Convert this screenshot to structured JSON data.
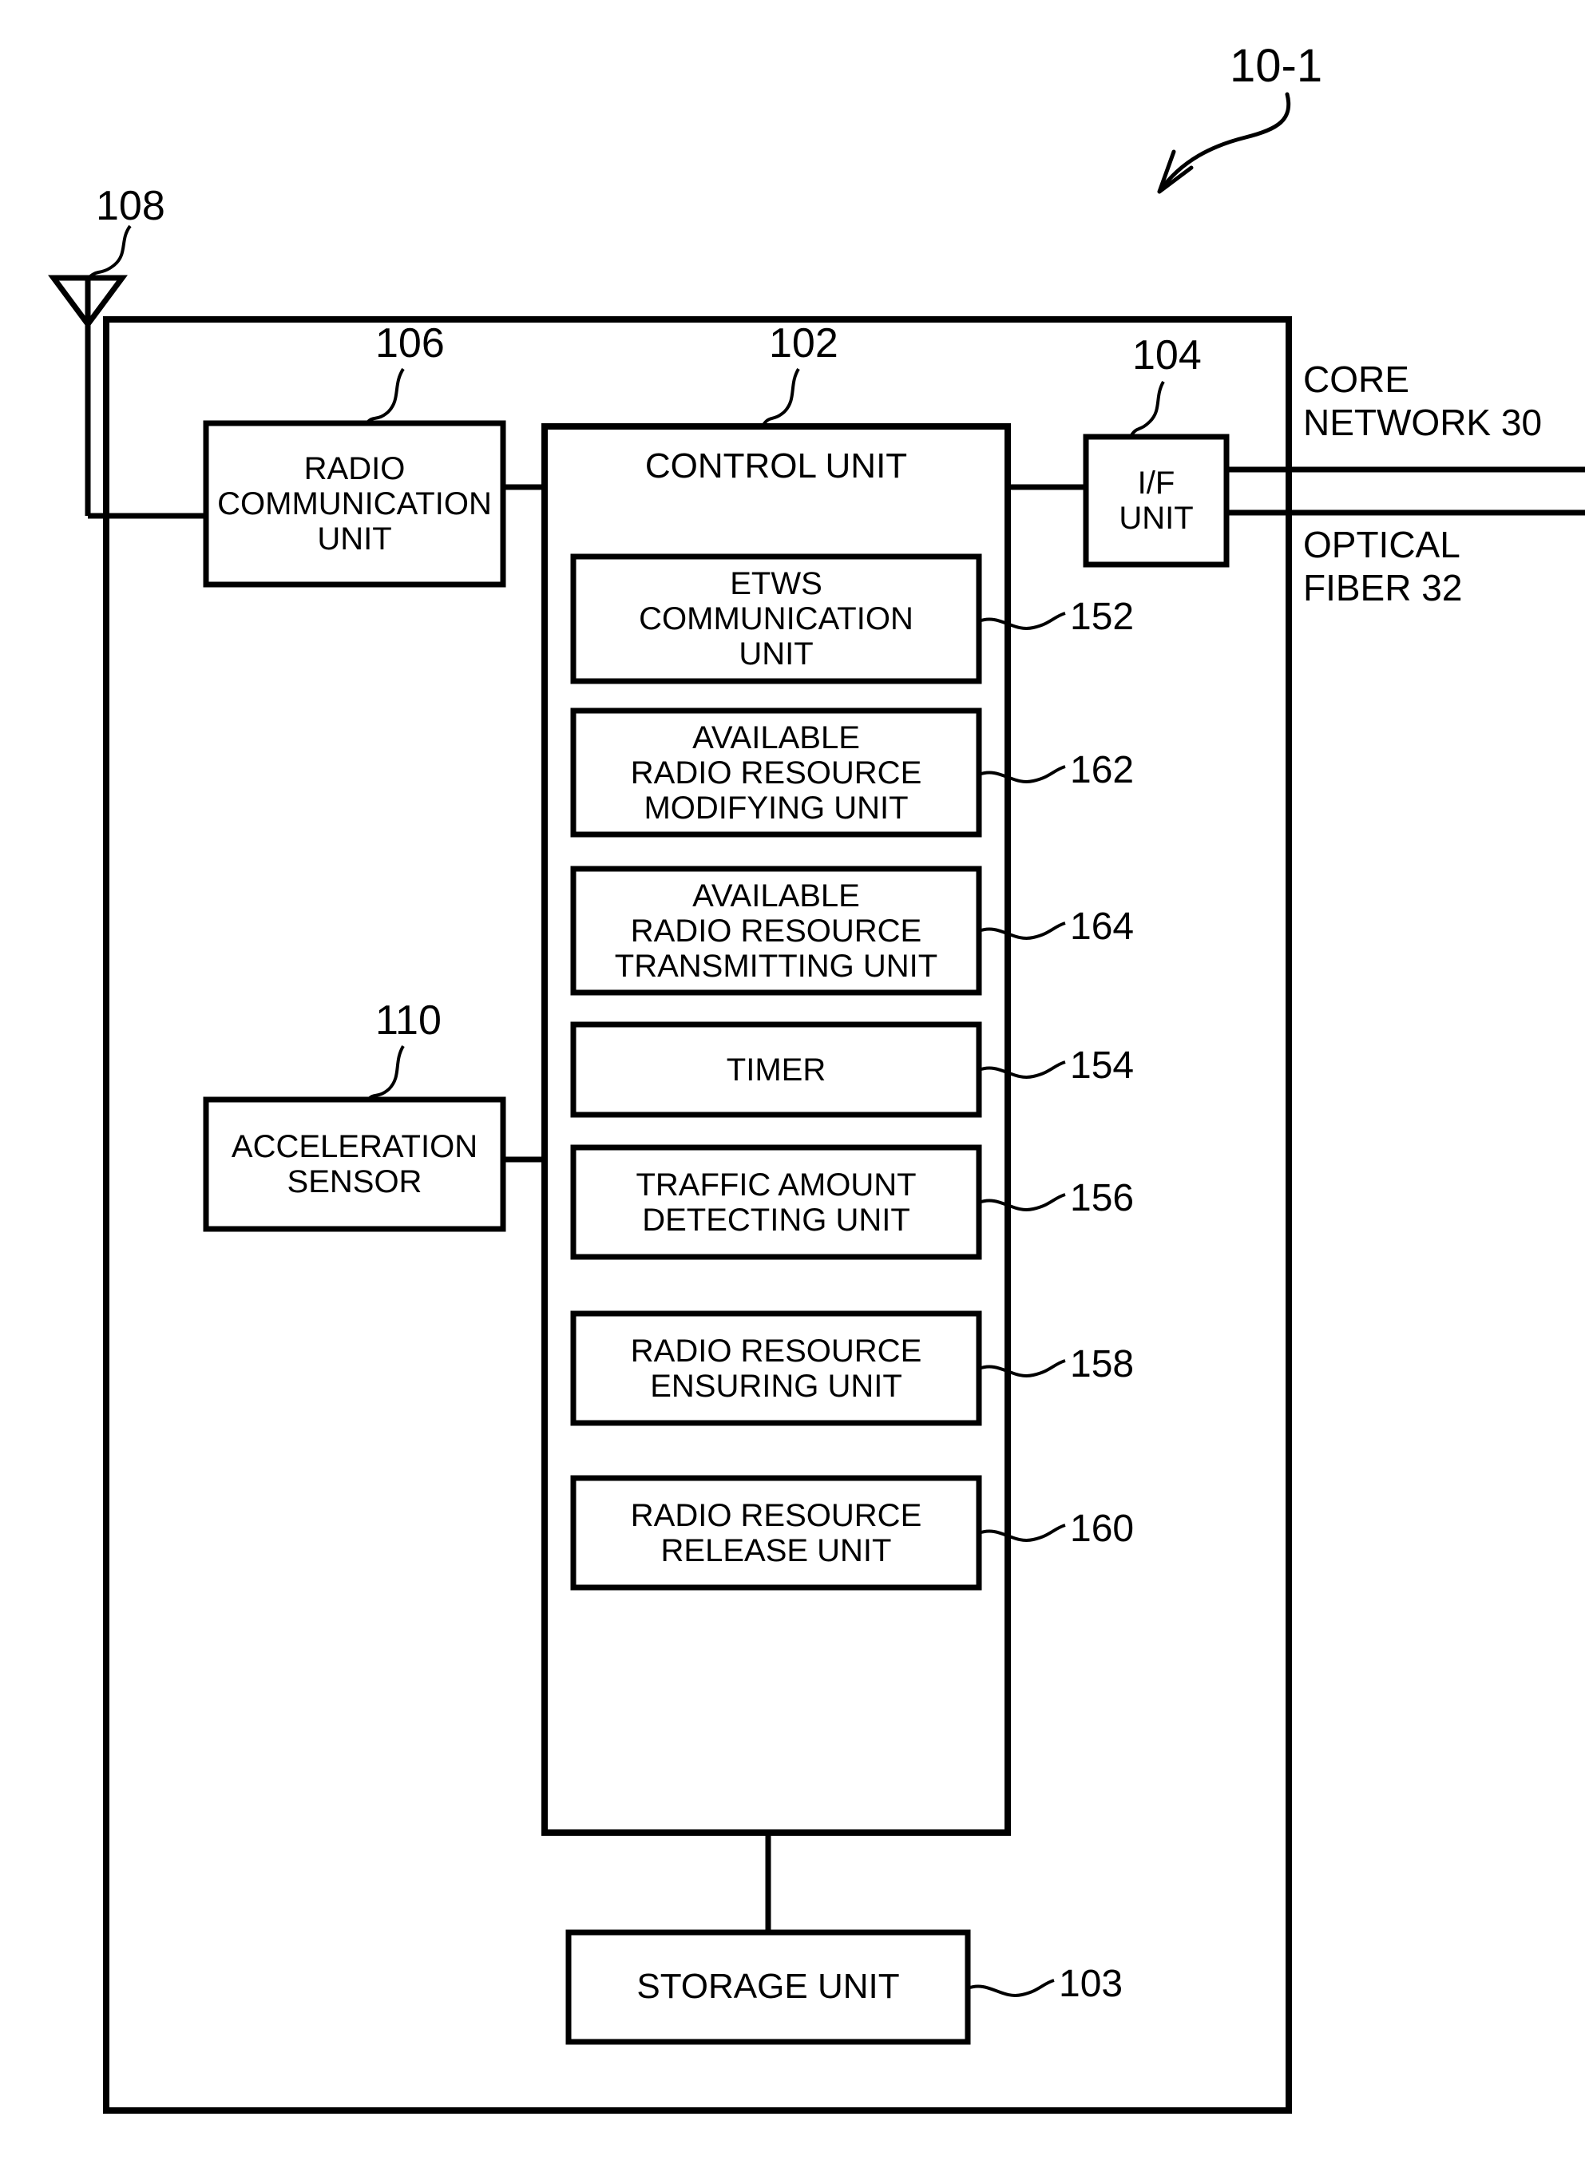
{
  "figure": {
    "id_label": "10-1",
    "outer_box_ref": "10-1"
  },
  "antenna": {
    "ref": "108",
    "name": "antenna"
  },
  "blocks": {
    "radio_communication_unit": {
      "label": "RADIO\nCOMMUNICATION\nUNIT",
      "ref": "106"
    },
    "control_unit": {
      "label": "CONTROL UNIT",
      "ref": "102"
    },
    "if_unit": {
      "label": "I/F\nUNIT",
      "ref": "104"
    },
    "acceleration_sensor": {
      "label": "ACCELERATION\nSENSOR",
      "ref": "110"
    },
    "storage_unit": {
      "label": "STORAGE UNIT",
      "ref": "103"
    }
  },
  "control_unit_children": [
    {
      "label": "ETWS\nCOMMUNICATION\nUNIT",
      "ref": "152"
    },
    {
      "label": "AVAILABLE\nRADIO RESOURCE\nMODIFYING UNIT",
      "ref": "162"
    },
    {
      "label": "AVAILABLE\nRADIO RESOURCE\nTRANSMITTING UNIT",
      "ref": "164"
    },
    {
      "label": "TIMER",
      "ref": "154"
    },
    {
      "label": "TRAFFIC AMOUNT\nDETECTING UNIT",
      "ref": "156"
    },
    {
      "label": "RADIO RESOURCE\nENSURING UNIT",
      "ref": "158"
    },
    {
      "label": "RADIO RESOURCE\nRELEASE UNIT",
      "ref": "160"
    }
  ],
  "external_links": {
    "core_network": "CORE\nNETWORK 30",
    "optical_fiber": "OPTICAL\nFIBER 32"
  },
  "colors": {
    "line": "#000000",
    "background": "#ffffff"
  }
}
